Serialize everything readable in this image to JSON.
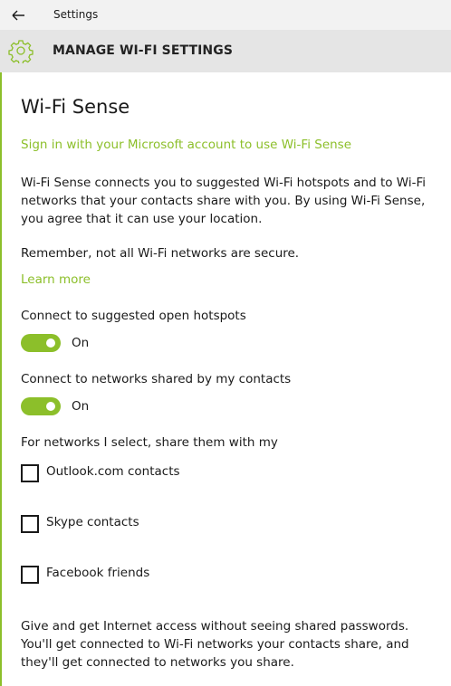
{
  "window": {
    "title": "Settings"
  },
  "header": {
    "title": "MANAGE WI-FI SETTINGS"
  },
  "section": {
    "heading": "Wi-Fi Sense",
    "signin_link": "Sign in with your Microsoft account to use Wi-Fi Sense",
    "description": "Wi-Fi Sense connects you to suggested Wi-Fi hotspots and to Wi-Fi networks that your contacts share with you. By using Wi-Fi Sense, you agree that it can use your location.",
    "reminder": "Remember, not all Wi-Fi networks are secure.",
    "learn_more": "Learn more"
  },
  "toggles": [
    {
      "label": "Connect to suggested open hotspots",
      "state": "On",
      "on": true
    },
    {
      "label": "Connect to networks shared by my contacts",
      "state": "On",
      "on": true
    }
  ],
  "share": {
    "label": "For networks I select, share them with my",
    "options": [
      {
        "label": "Outlook.com contacts",
        "checked": false
      },
      {
        "label": "Skype contacts",
        "checked": false
      },
      {
        "label": "Facebook friends",
        "checked": false
      }
    ]
  },
  "footer": {
    "text": "Give and get Internet access without seeing shared passwords. You'll get connected to Wi-Fi networks your contacts share, and they'll get connected to networks you share."
  },
  "colors": {
    "accent": "#8cbf2a",
    "titlebar": "#f2f2f2",
    "header": "#e5e5e5"
  },
  "icons": {
    "back": "back-arrow-icon",
    "settings": "gear-icon"
  }
}
